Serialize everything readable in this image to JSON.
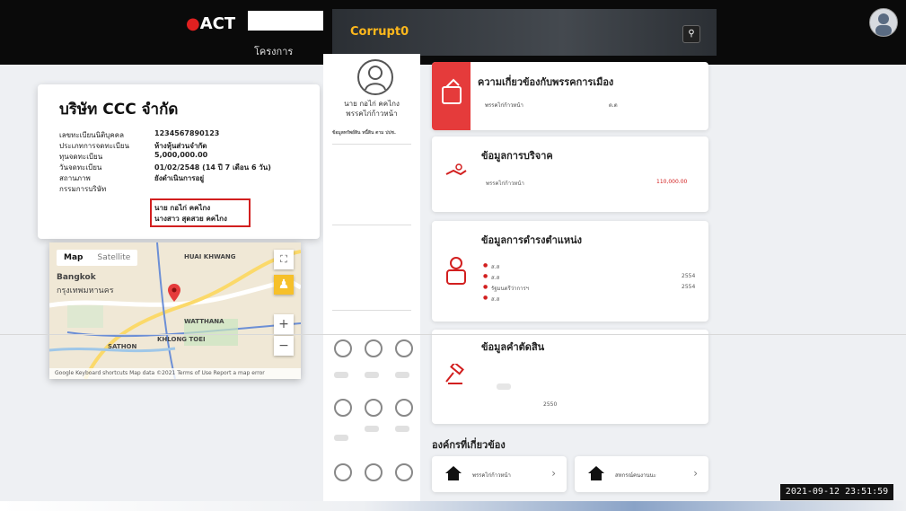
{
  "header": {
    "logo_text": "ACT",
    "nav_label": "โครงการ"
  },
  "hero": {
    "brand": "Corrupt0",
    "search_glyph": "⚲"
  },
  "company": {
    "name": "บริษัท CCC จำกัด",
    "rows": [
      {
        "label": "เลขทะเบียนนิติบุคคล",
        "value": "1234567890123"
      },
      {
        "label": "ประเภทการจดทะเบียน",
        "value": "ห้างหุ้นส่วนจำกัด"
      },
      {
        "label": "ทุนจดทะเบียน",
        "value": "5,000,000.00"
      },
      {
        "label": "วันจดทะเบียน",
        "value": "01/02/2548 (14 ปี 7 เดือน 6 วัน)"
      },
      {
        "label": "สถานภาพ",
        "value": "ยังดำเนินการอยู่"
      },
      {
        "label": "กรรมการบริษัท",
        "value": "นาย กอไก่ คคไกง"
      }
    ],
    "director2": "นางสาว สุดสวย คคไกง"
  },
  "map": {
    "tab_map": "Map",
    "tab_satellite": "Satellite",
    "labels": [
      "Bangkok",
      "กรุงเทพมหานคร",
      "HUAI KHWANG",
      "WATTHANA",
      "KHLONG TOEI",
      "SATHON"
    ],
    "footer": "Google  Keyboard shortcuts  Map data ©2021  Terms of Use  Report a map error",
    "zoom_in": "+",
    "zoom_out": "−",
    "fullscreen": "⛶"
  },
  "profile": {
    "name": "นาย กอไก่ คคไกง",
    "party": "พรรคไก่ก้าวหน้า",
    "heading": "ข้อมูลทรัพย์สิน หนี้สิน ตาม ปปช."
  },
  "sections": {
    "politics": {
      "title": "ความเกี่ยวข้องกับพรรคการเมือง",
      "party_label": "พรรคไก่ก้าวหน้า",
      "role": "ต.ต"
    },
    "donation": {
      "title": "ข้อมูลการบริจาค",
      "party_label": "พรรคไก่ก้าวหน้า",
      "amount": "110,000.00"
    },
    "positions": {
      "title": "ข้อมูลการดำรงตำแหน่ง",
      "items": [
        {
          "text": "ส.ส",
          "year": ""
        },
        {
          "text": "ส.ส",
          "year": "2554"
        },
        {
          "text": "รัฐมนตรีว่าการฯ",
          "year": "2554"
        },
        {
          "text": "ส.ส",
          "year": ""
        }
      ]
    },
    "verdict": {
      "title": "ข้อมูลคำตัดสิน",
      "year": "2550"
    }
  },
  "orgs": {
    "heading": "องค์กรที่เกี่ยวข้อง",
    "items": [
      "พรรคไก่ก้าวหน้า",
      "สหกรณ์คนงานนะ"
    ]
  },
  "timestamp": "2021-09-12 23:51:59"
}
